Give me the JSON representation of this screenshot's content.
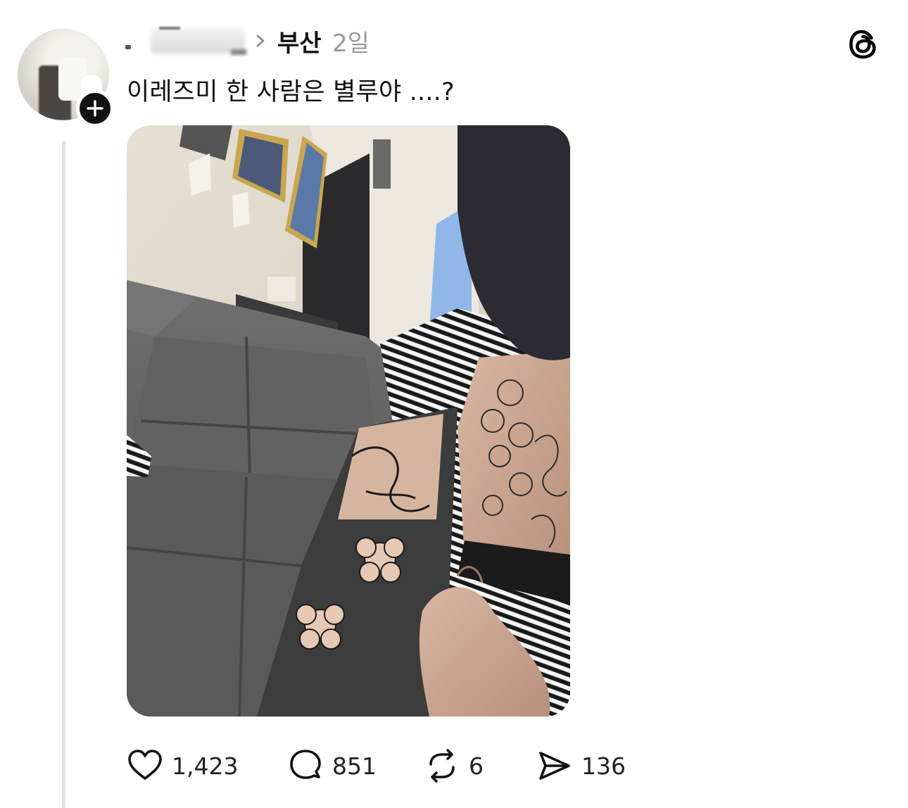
{
  "header": {
    "location": "부산",
    "timestamp": "2일"
  },
  "post": {
    "text": "이레즈미 한 사람은 별루야 ....?"
  },
  "icons": {
    "avatar_badge": "plus-icon",
    "breadcrumb": "chevron-right-icon",
    "brand": "threads-logo-icon",
    "like": "heart-icon",
    "reply": "speech-bubble-icon",
    "repost": "repost-icon",
    "share": "send-icon"
  },
  "actions": {
    "like_count": "1,423",
    "reply_count": "851",
    "repost_count": "6",
    "share_count": "136"
  },
  "colors": {
    "text": "#111111",
    "secondary": "#9a9a9a",
    "thread_line": "#e4e4e4"
  }
}
